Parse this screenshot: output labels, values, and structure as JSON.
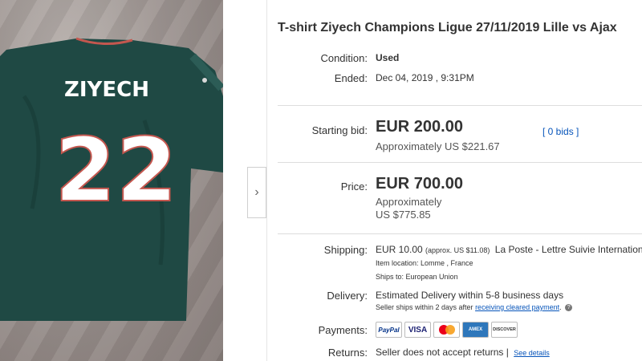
{
  "listing": {
    "title": "T-shirt Ziyech Champions Ligue 27/11/2019 Lille vs Ajax",
    "photo": {
      "jersey_name": "ZIYECH",
      "jersey_number": "22"
    }
  },
  "details": {
    "condition_label": "Condition:",
    "condition_value": "Used",
    "ended_label": "Ended:",
    "ended_value": "Dec 04, 2019 , 9:31PM"
  },
  "bid": {
    "starting_label": "Starting bid:",
    "starting_value": "EUR 200.00",
    "starting_approx": "Approximately US $221.67",
    "bids_link": "[ 0 bids ]"
  },
  "price": {
    "label": "Price:",
    "value": "EUR 700.00",
    "approx_line1": "Approximately",
    "approx_line2": "US $775.85"
  },
  "shipping": {
    "label": "Shipping:",
    "cost": "EUR 10.00",
    "approx": "(approx. US $11.08)",
    "service": "La Poste - Lettre Suivie International",
    "item_location": "Item location:  Lomme , France",
    "ships_to": "Ships to:  European Union"
  },
  "delivery": {
    "label": "Delivery:",
    "estimate": "Estimated Delivery within 5-8 business days",
    "note_prefix": "Seller ships within 2 days after ",
    "note_link": "receiving cleared payment",
    "note_suffix": "."
  },
  "payments": {
    "label": "Payments:",
    "methods": [
      "PayPal",
      "VISA",
      "Mastercard",
      "AMEX",
      "DISCOVER"
    ]
  },
  "returns": {
    "label": "Returns:",
    "text": "Seller does not accept returns |",
    "link": "See details"
  },
  "gallery": {
    "next_arrow": "›"
  },
  "colors": {
    "link": "#0654ba",
    "jersey": "#1f4944"
  }
}
